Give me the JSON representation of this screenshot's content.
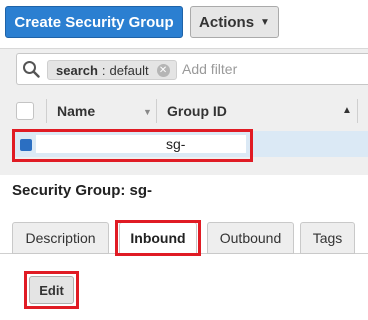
{
  "toolbar": {
    "create_label": "Create Security Group",
    "actions_label": "Actions"
  },
  "filter": {
    "token_key": "search",
    "token_sep": ":",
    "token_value": "default",
    "placeholder": "Add filter"
  },
  "table": {
    "columns": [
      "Name",
      "Group ID"
    ],
    "selected_row": {
      "group_id": "sg-"
    }
  },
  "details": {
    "title": "Security Group: sg-",
    "tabs": [
      "Description",
      "Inbound",
      "Outbound",
      "Tags"
    ],
    "active_tab": "Inbound",
    "edit_label": "Edit"
  },
  "colors": {
    "primary": "#2b7fd1",
    "highlight": "#e01b24",
    "selected_row": "#dbe9f5"
  }
}
